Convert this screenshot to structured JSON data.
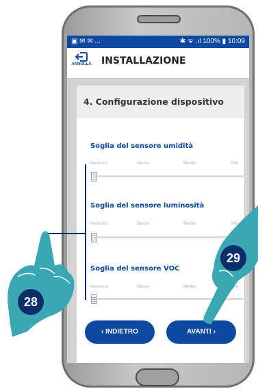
{
  "statusbar": {
    "left_icons": "▣ ✉ ✉ ...",
    "right_text": "✱ ᯤ .ıl 100% ▮ 10:09"
  },
  "appbar": {
    "back_label": "ANNULLA",
    "title": "INSTALLAZIONE"
  },
  "card": {
    "title": "4. Configurazione dispositivo",
    "sensors": [
      {
        "label": "Soglia del sensore umidità",
        "levels": [
          "Nessuno",
          "Basso",
          "Medio",
          "Alto"
        ],
        "value": "Nessuno"
      },
      {
        "label": "Soglia del sensore luminosità",
        "levels": [
          "Nessuno",
          "Basso",
          "Medio",
          "Alto"
        ],
        "value": "Nessuno"
      },
      {
        "label": "Soglia del sensore VOC",
        "levels": [
          "Nessuno",
          "Basso",
          "Medio",
          "Alto"
        ],
        "value": "Nessuno"
      }
    ]
  },
  "buttons": {
    "back": "‹ INDIETRO",
    "next": "AVANTI ›"
  },
  "callouts": {
    "left": "28",
    "right": "29"
  },
  "colors": {
    "primary": "#0b4aa0",
    "hand": "#3aa7b5"
  }
}
